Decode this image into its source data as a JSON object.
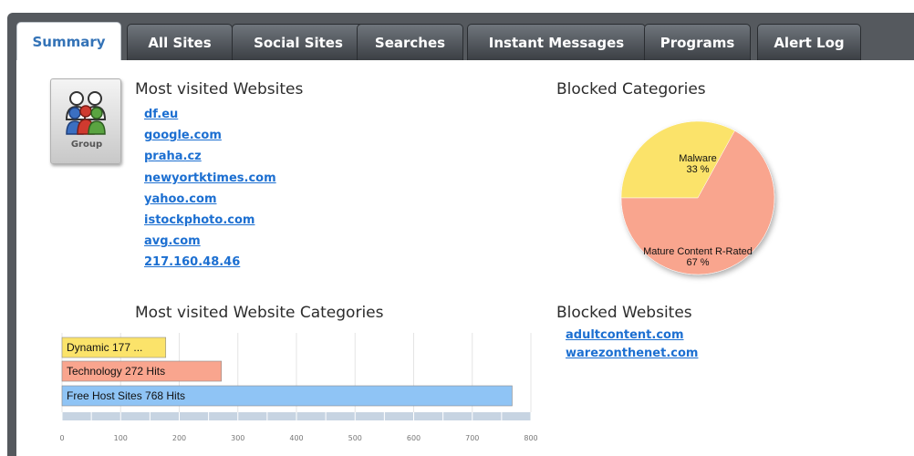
{
  "tabs": [
    {
      "label": "Summary",
      "active": true
    },
    {
      "label": "All Sites",
      "active": false
    },
    {
      "label": "Social Sites",
      "active": false
    },
    {
      "label": "Searches",
      "active": false
    },
    {
      "label": "Instant Messages",
      "active": false
    },
    {
      "label": "Programs",
      "active": false
    },
    {
      "label": "Alert Log",
      "active": false
    }
  ],
  "group": {
    "label": "Group",
    "icon": "group-icon"
  },
  "most_visited": {
    "heading": "Most visited Websites",
    "sites": [
      "df.eu",
      "google.com",
      "praha.cz",
      "newyortktimes.com",
      "yahoo.com",
      "istockphoto.com",
      "avg.com",
      "217.160.48.46"
    ]
  },
  "blocked_categories": {
    "heading": "Blocked Categories"
  },
  "most_visited_categories": {
    "heading": "Most visited Website Categories"
  },
  "blocked_websites": {
    "heading": "Blocked Websites",
    "sites": [
      "adultcontent.com",
      "warezonthenet.com"
    ]
  },
  "colors": {
    "link": "#1c6fd1",
    "tab_active_text": "#3473b7",
    "pie_malware": "#fbe36a",
    "pie_mature": "#f9a58e",
    "bar_dynamic": "#fbe36a",
    "bar_technology": "#f9a58e",
    "bar_free_host": "#8fc4f5"
  },
  "chart_data": [
    {
      "type": "pie",
      "title": "Blocked Categories",
      "categories": [
        "Malware",
        "Mature Content R-Rated"
      ],
      "values": [
        33,
        67
      ],
      "labels": [
        "33 %",
        "67 %"
      ]
    },
    {
      "type": "bar",
      "orientation": "horizontal",
      "title": "Most visited Website Categories",
      "categories": [
        "Dynamic",
        "Technology",
        "Free Host Sites"
      ],
      "values": [
        177,
        272,
        768
      ],
      "bar_labels": [
        "Dynamic 177 ...",
        "Technology 272 Hits",
        "Free Host Sites 768 Hits"
      ],
      "xlim": [
        0,
        800
      ],
      "ticks": [
        "0",
        "100",
        "200",
        "300",
        "400",
        "500",
        "600",
        "700",
        "800"
      ],
      "grid": true
    }
  ]
}
